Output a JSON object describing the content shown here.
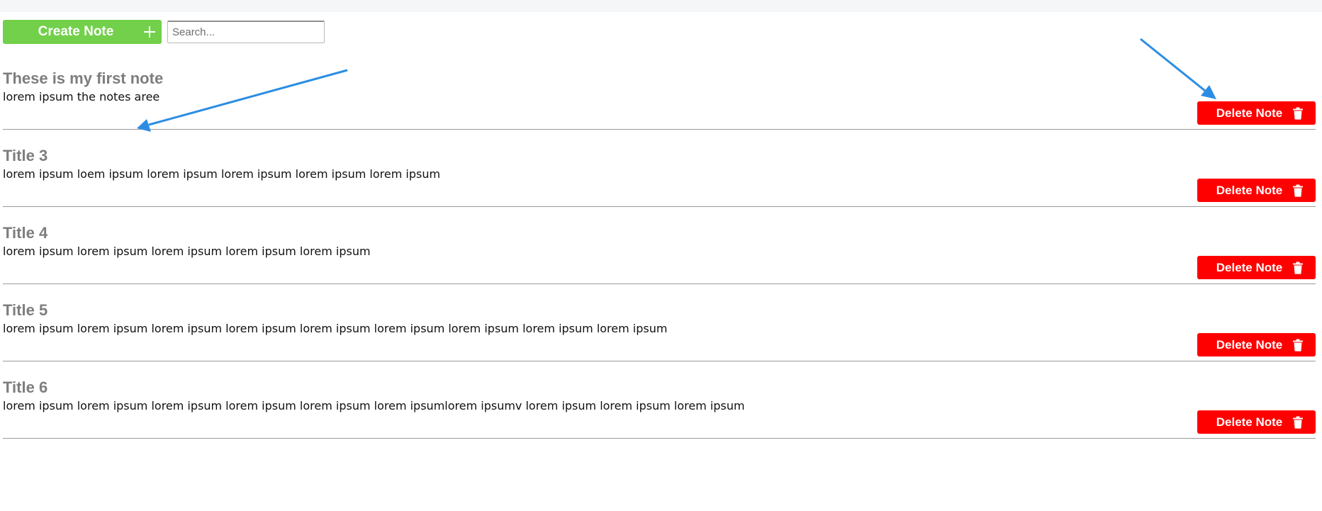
{
  "colors": {
    "create_button": "#72d04b",
    "delete_button": "#ff0000",
    "title_text": "#7d7d7d",
    "body_text": "#111111",
    "divider": "#9a9a9a",
    "annotation_arrow": "#2b8de2"
  },
  "toolbar": {
    "create_label": "Create Note",
    "create_icon": "plus-icon",
    "search_placeholder": "Search...",
    "search_value": ""
  },
  "notes": [
    {
      "title": "These is my first note",
      "body": "lorem ipsum the notes aree",
      "delete_label": "Delete Note",
      "delete_icon": "trash-icon"
    },
    {
      "title": "Title 3",
      "body": "lorem ipsum loem ipsum lorem ipsum lorem ipsum lorem ipsum lorem ipsum",
      "delete_label": "Delete Note",
      "delete_icon": "trash-icon"
    },
    {
      "title": "Title 4",
      "body": "lorem ipsum lorem ipsum lorem ipsum lorem ipsum lorem ipsum",
      "delete_label": "Delete Note",
      "delete_icon": "trash-icon"
    },
    {
      "title": "Title 5",
      "body": "lorem ipsum lorem ipsum lorem ipsum lorem ipsum lorem ipsum lorem ipsum lorem ipsum lorem ipsum lorem ipsum",
      "delete_label": "Delete Note",
      "delete_icon": "trash-icon"
    },
    {
      "title": "Title 6",
      "body": "lorem ipsum lorem ipsum lorem ipsum lorem ipsum lorem ipsum lorem ipsumlorem ipsumv lorem ipsum lorem ipsum lorem ipsum",
      "delete_label": "Delete Note",
      "delete_icon": "trash-icon"
    }
  ]
}
